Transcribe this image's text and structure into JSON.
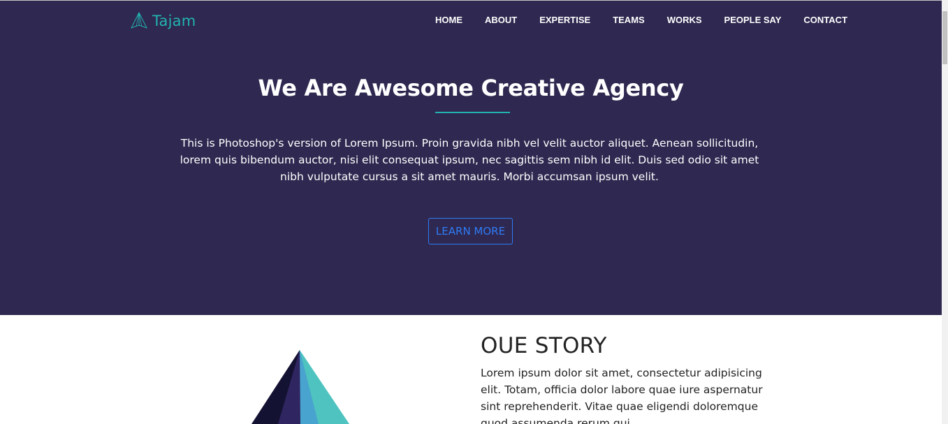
{
  "brand": {
    "name": "Tajam",
    "logo_icon": "pyramid-outline-icon",
    "color": "#22b3b0"
  },
  "nav": {
    "items": [
      {
        "label": "HOME"
      },
      {
        "label": "ABOUT"
      },
      {
        "label": "EXPERTISE"
      },
      {
        "label": "TEAMS"
      },
      {
        "label": "WORKS"
      },
      {
        "label": "PEOPLE SAY"
      },
      {
        "label": "CONTACT"
      }
    ]
  },
  "hero": {
    "title": "We Are Awesome Creative Agency",
    "text": "This is Photoshop's version of Lorem Ipsum. Proin gravida nibh vel velit auctor aliquet. Aenean sollicitudin, lorem quis bibendum auctor, nisi elit consequat ipsum, nec sagittis sem nibh id elit. Duis sed odio sit amet nibh vulputate cursus a sit amet mauris. Morbi accumsan ipsum velit.",
    "button_label": "LEARN MORE",
    "background": "#2f2850",
    "accent": "#22b3b0",
    "button_color": "#2f7cf6"
  },
  "story": {
    "title": "OUE STORY",
    "text": "Lorem ipsum dolor sit amet, consectetur adipisicing elit. Totam, officia dolor labore quae iure aspernatur sint reprehenderit. Vitae quae eligendi doloremque quod assumenda rerum qui",
    "image_icon": "pyramid-illustration-icon"
  }
}
